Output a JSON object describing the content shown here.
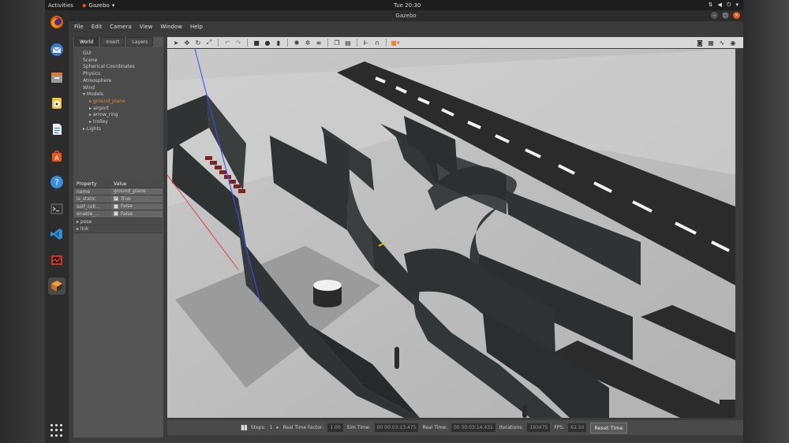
{
  "topbar": {
    "activities": "Activities",
    "app_name": "Gazebo",
    "clock": "Tue 20:30"
  },
  "window": {
    "title": "Gazebo"
  },
  "menubar": [
    "File",
    "Edit",
    "Camera",
    "View",
    "Window",
    "Help"
  ],
  "left_panel": {
    "tabs": [
      "World",
      "Insert",
      "Layers"
    ],
    "tree": {
      "items": [
        "GUI",
        "Scene",
        "Spherical Coordinates",
        "Physics",
        "Atmosphere",
        "Wind"
      ],
      "models_label": "Models",
      "models": [
        "ground_plane",
        "airport",
        "arrow_ring",
        "trolley"
      ],
      "lights_label": "Lights"
    },
    "props_header": {
      "property": "Property",
      "value": "Value"
    },
    "props": [
      {
        "k": "name",
        "v": "ground_plane"
      },
      {
        "k": "is_static",
        "v": "True",
        "check": true
      },
      {
        "k": "self_coll...",
        "v": "False",
        "check": false
      },
      {
        "k": "enable_...",
        "v": "False",
        "check": false
      }
    ],
    "folds": [
      "pose",
      "link"
    ]
  },
  "bottom": {
    "steps_label": "Steps:",
    "steps_value": "1",
    "rtf_label": "Real Time Factor:",
    "rtf_value": "1.00",
    "sim_label": "Sim Time:",
    "sim_value": "00 00:03:13.475",
    "real_label": "Real Time:",
    "real_value": "00 00:03:14.431",
    "iter_label": "Iterations:",
    "iter_value": "193475",
    "fps_label": "FPS:",
    "fps_value": "62.50",
    "reset_label": "Reset Time"
  },
  "colors": {
    "accent": "#e9541f",
    "selected": "#e08a3a",
    "wall": "#2f3333",
    "road": "#2b2b2b",
    "floor": "#bdbdbd"
  }
}
